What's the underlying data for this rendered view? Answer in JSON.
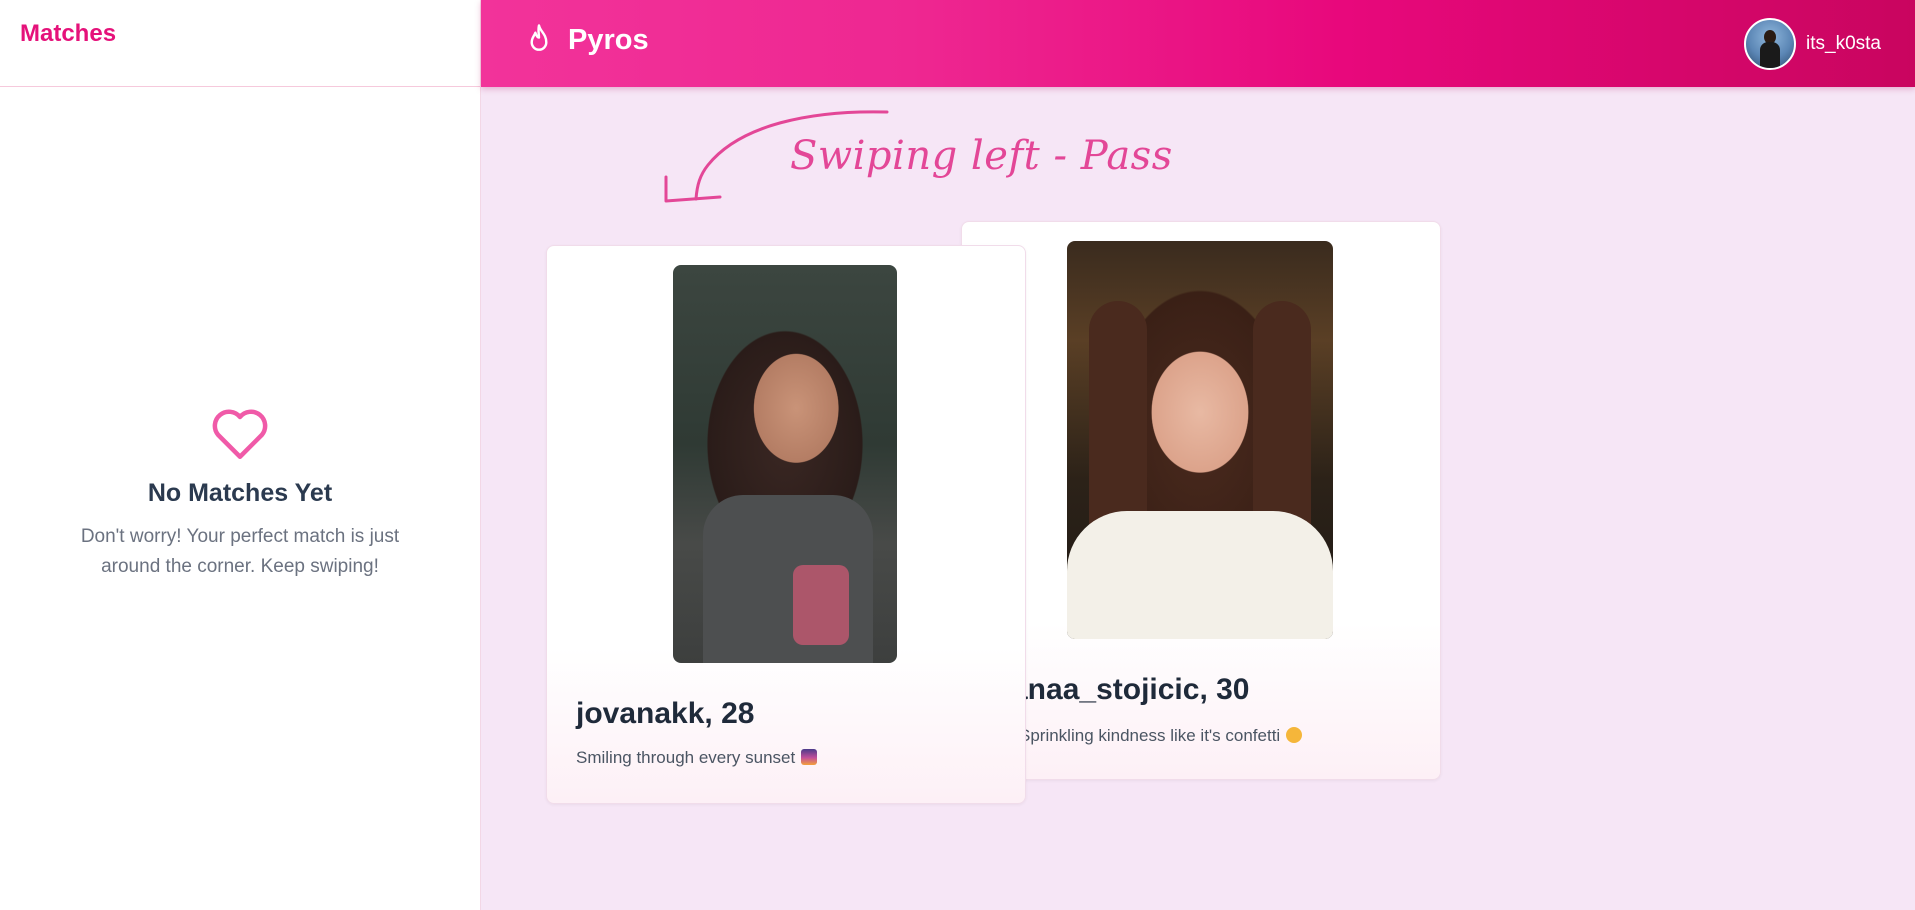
{
  "sidebar": {
    "title": "Matches",
    "empty_state": {
      "icon": "heart-icon",
      "title": "No Matches Yet",
      "text": "Don't worry! Your perfect match is just around the corner. Keep swiping!"
    }
  },
  "header": {
    "brand_icon": "flame-icon",
    "brand_name": "Pyros",
    "username": "its_k0sta"
  },
  "annotation": {
    "text": "Swiping left - Pass",
    "arrow_icon": "curved-arrow-icon"
  },
  "cards": {
    "front": {
      "name_age": "jovanakk, 28",
      "bio": "Smiling through every sunset",
      "emoji": "sunset-emoji"
    },
    "back": {
      "name_age": "anaa_stojicic, 30",
      "bio": "Sprinkling kindness like it's confetti",
      "emoji": "heart-hands-emoji"
    }
  },
  "colors": {
    "brand_pink": "#e5127a",
    "header_gradient_start": "#f2339a",
    "header_gradient_end": "#c9055f",
    "page_background": "#f6e6f6",
    "annotation_pink": "#e34797"
  }
}
